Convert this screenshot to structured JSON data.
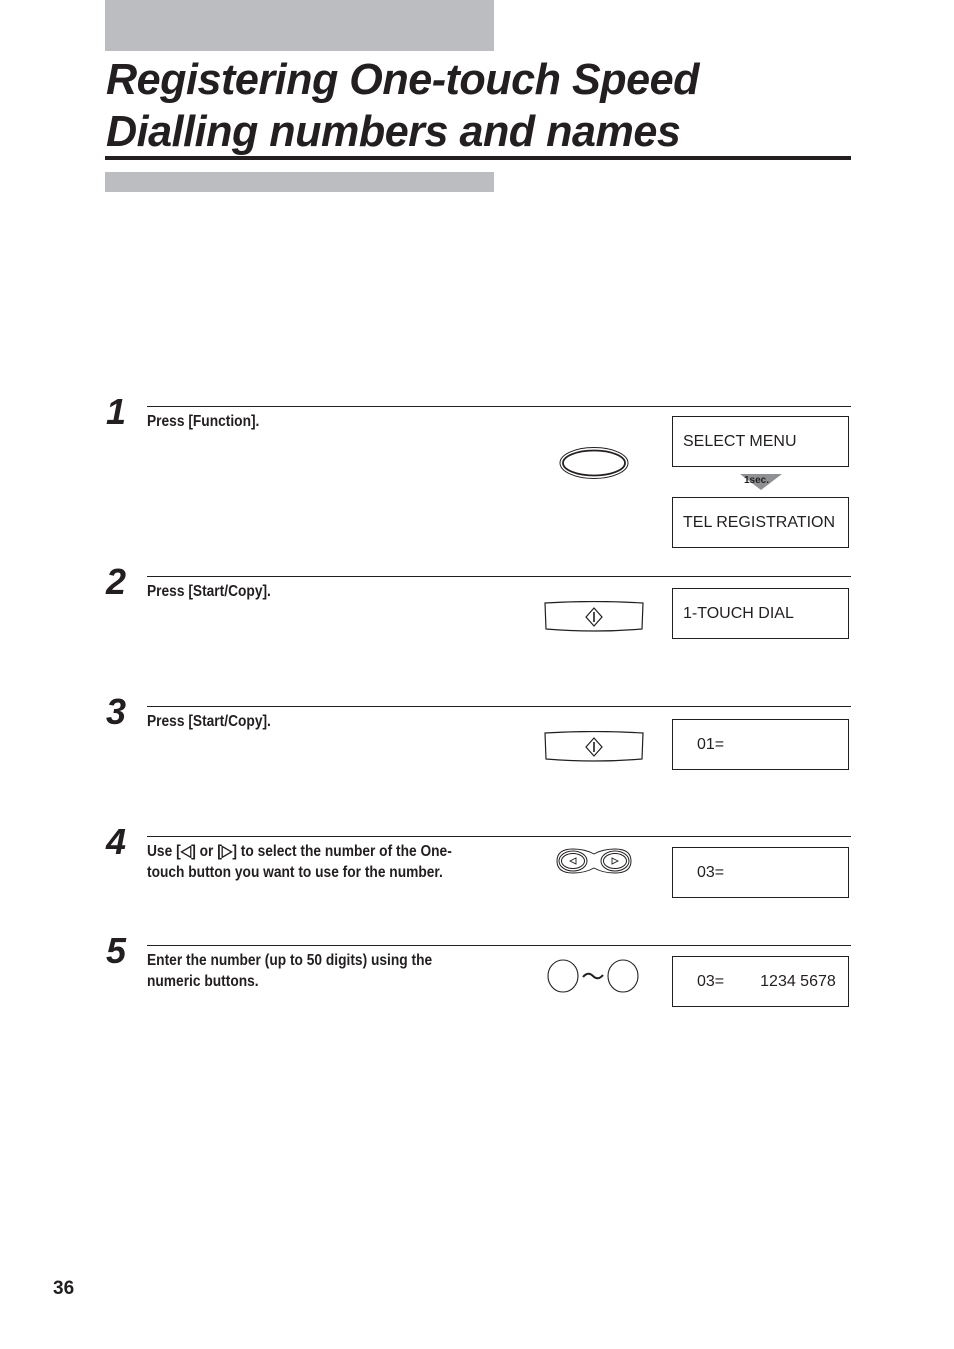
{
  "page": {
    "title_line1": "Registering One-touch Speed",
    "title_line2": "Dialling numbers and names",
    "page_number": "36"
  },
  "steps": [
    {
      "number": "1",
      "text": "Press [Function].",
      "button_icon": "function-button-icon",
      "displays": [
        "SELECT MENU",
        "TEL REGISTRATION"
      ],
      "transition_label": "1sec."
    },
    {
      "number": "2",
      "text": "Press [Start/Copy].",
      "button_icon": "start-copy-button-icon",
      "displays": [
        "1-TOUCH DIAL"
      ]
    },
    {
      "number": "3",
      "text": "Press [Start/Copy].",
      "button_icon": "start-copy-button-icon",
      "displays": [
        "01="
      ]
    },
    {
      "number": "4",
      "text_line1": "Use [◁] or [▷] to select the number of the One-",
      "text_line2": "touch button you want to use for the number.",
      "button_icon": "left-right-arrow-buttons-icon",
      "displays": [
        "03="
      ]
    },
    {
      "number": "5",
      "text_line1": "Enter the number (up to 50 digits) using the",
      "text_line2": "numeric buttons.",
      "button_icon": "numeric-buttons-icon",
      "range_symbol": "~",
      "display_prefix": "03=",
      "display_value": "1234 5678"
    }
  ]
}
